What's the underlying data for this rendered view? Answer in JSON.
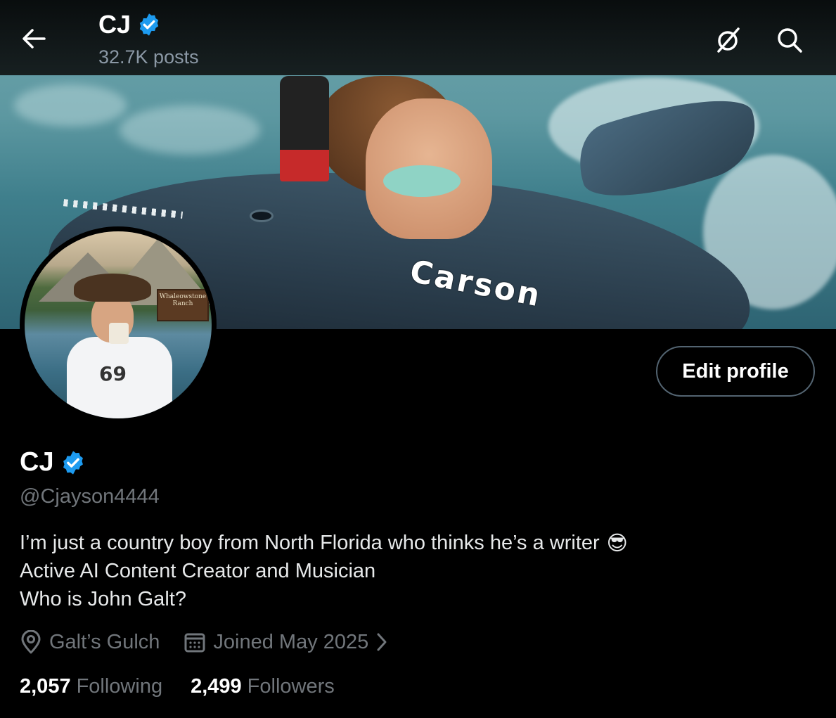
{
  "header": {
    "name": "CJ",
    "posts": "32.7K posts"
  },
  "banner": {
    "overlay_text": "Carson"
  },
  "avatar": {
    "sign_text": "Whaleowstone Ranch",
    "jersey_number": "69"
  },
  "actions": {
    "edit_profile_label": "Edit profile"
  },
  "profile": {
    "name": "CJ",
    "handle": "@Cjayson4444",
    "bio": [
      "I’m just a country boy from North Florida who thinks he’s a writer",
      "Active AI Content Creator and Musician",
      "Who is John Galt?"
    ],
    "bio_emoji": "😎",
    "location": "Galt’s Gulch",
    "joined": "Joined May 2025",
    "following_count": "2,057",
    "following_label": "Following",
    "followers_count": "2,499",
    "followers_label": "Followers"
  },
  "colors": {
    "verified": "#1d9bf0",
    "muted_text": "#71767b",
    "background": "#000000",
    "button_border": "#536471"
  },
  "icons": [
    "back-arrow-icon",
    "verified-badge-icon",
    "grok-icon",
    "search-icon",
    "location-pin-icon",
    "calendar-icon",
    "chevron-right-icon",
    "sunglasses-emoji"
  ]
}
